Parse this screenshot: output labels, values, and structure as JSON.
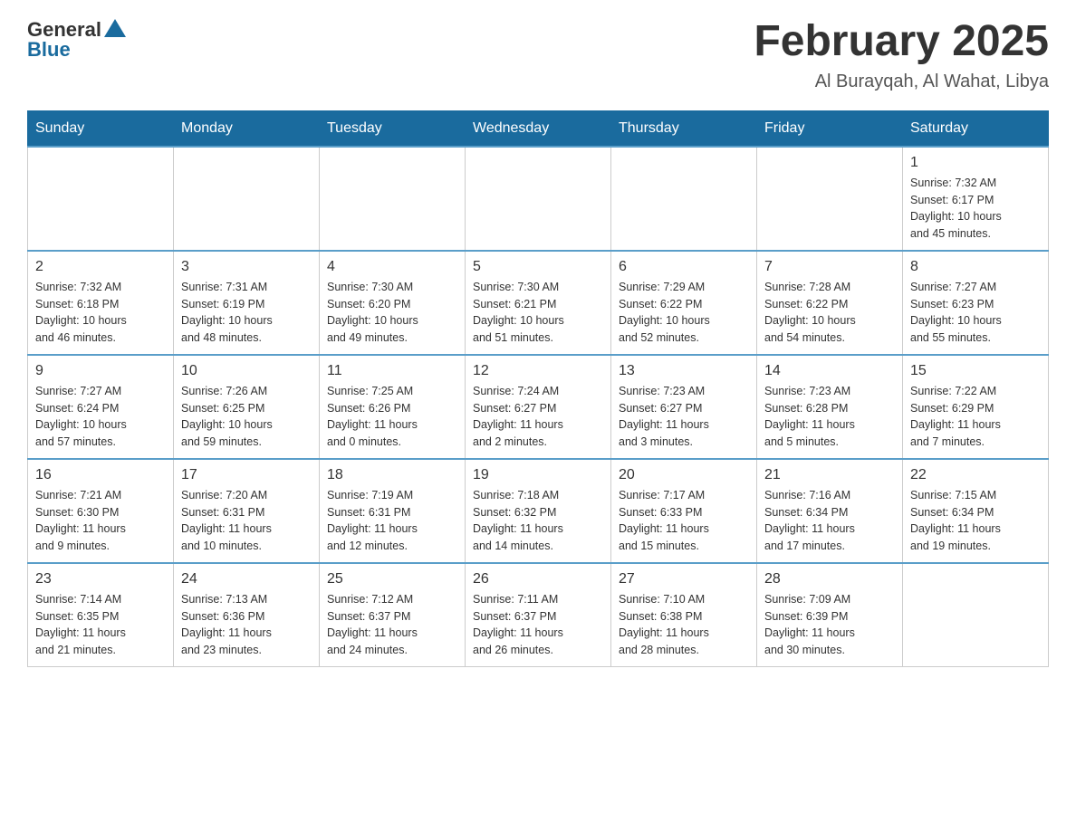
{
  "header": {
    "logo": {
      "text_general": "General",
      "text_blue": "Blue"
    },
    "title": "February 2025",
    "subtitle": "Al Burayqah, Al Wahat, Libya"
  },
  "days_of_week": [
    "Sunday",
    "Monday",
    "Tuesday",
    "Wednesday",
    "Thursday",
    "Friday",
    "Saturday"
  ],
  "weeks": [
    {
      "days": [
        {
          "num": "",
          "info": ""
        },
        {
          "num": "",
          "info": ""
        },
        {
          "num": "",
          "info": ""
        },
        {
          "num": "",
          "info": ""
        },
        {
          "num": "",
          "info": ""
        },
        {
          "num": "",
          "info": ""
        },
        {
          "num": "1",
          "info": "Sunrise: 7:32 AM\nSunset: 6:17 PM\nDaylight: 10 hours\nand 45 minutes."
        }
      ]
    },
    {
      "days": [
        {
          "num": "2",
          "info": "Sunrise: 7:32 AM\nSunset: 6:18 PM\nDaylight: 10 hours\nand 46 minutes."
        },
        {
          "num": "3",
          "info": "Sunrise: 7:31 AM\nSunset: 6:19 PM\nDaylight: 10 hours\nand 48 minutes."
        },
        {
          "num": "4",
          "info": "Sunrise: 7:30 AM\nSunset: 6:20 PM\nDaylight: 10 hours\nand 49 minutes."
        },
        {
          "num": "5",
          "info": "Sunrise: 7:30 AM\nSunset: 6:21 PM\nDaylight: 10 hours\nand 51 minutes."
        },
        {
          "num": "6",
          "info": "Sunrise: 7:29 AM\nSunset: 6:22 PM\nDaylight: 10 hours\nand 52 minutes."
        },
        {
          "num": "7",
          "info": "Sunrise: 7:28 AM\nSunset: 6:22 PM\nDaylight: 10 hours\nand 54 minutes."
        },
        {
          "num": "8",
          "info": "Sunrise: 7:27 AM\nSunset: 6:23 PM\nDaylight: 10 hours\nand 55 minutes."
        }
      ]
    },
    {
      "days": [
        {
          "num": "9",
          "info": "Sunrise: 7:27 AM\nSunset: 6:24 PM\nDaylight: 10 hours\nand 57 minutes."
        },
        {
          "num": "10",
          "info": "Sunrise: 7:26 AM\nSunset: 6:25 PM\nDaylight: 10 hours\nand 59 minutes."
        },
        {
          "num": "11",
          "info": "Sunrise: 7:25 AM\nSunset: 6:26 PM\nDaylight: 11 hours\nand 0 minutes."
        },
        {
          "num": "12",
          "info": "Sunrise: 7:24 AM\nSunset: 6:27 PM\nDaylight: 11 hours\nand 2 minutes."
        },
        {
          "num": "13",
          "info": "Sunrise: 7:23 AM\nSunset: 6:27 PM\nDaylight: 11 hours\nand 3 minutes."
        },
        {
          "num": "14",
          "info": "Sunrise: 7:23 AM\nSunset: 6:28 PM\nDaylight: 11 hours\nand 5 minutes."
        },
        {
          "num": "15",
          "info": "Sunrise: 7:22 AM\nSunset: 6:29 PM\nDaylight: 11 hours\nand 7 minutes."
        }
      ]
    },
    {
      "days": [
        {
          "num": "16",
          "info": "Sunrise: 7:21 AM\nSunset: 6:30 PM\nDaylight: 11 hours\nand 9 minutes."
        },
        {
          "num": "17",
          "info": "Sunrise: 7:20 AM\nSunset: 6:31 PM\nDaylight: 11 hours\nand 10 minutes."
        },
        {
          "num": "18",
          "info": "Sunrise: 7:19 AM\nSunset: 6:31 PM\nDaylight: 11 hours\nand 12 minutes."
        },
        {
          "num": "19",
          "info": "Sunrise: 7:18 AM\nSunset: 6:32 PM\nDaylight: 11 hours\nand 14 minutes."
        },
        {
          "num": "20",
          "info": "Sunrise: 7:17 AM\nSunset: 6:33 PM\nDaylight: 11 hours\nand 15 minutes."
        },
        {
          "num": "21",
          "info": "Sunrise: 7:16 AM\nSunset: 6:34 PM\nDaylight: 11 hours\nand 17 minutes."
        },
        {
          "num": "22",
          "info": "Sunrise: 7:15 AM\nSunset: 6:34 PM\nDaylight: 11 hours\nand 19 minutes."
        }
      ]
    },
    {
      "days": [
        {
          "num": "23",
          "info": "Sunrise: 7:14 AM\nSunset: 6:35 PM\nDaylight: 11 hours\nand 21 minutes."
        },
        {
          "num": "24",
          "info": "Sunrise: 7:13 AM\nSunset: 6:36 PM\nDaylight: 11 hours\nand 23 minutes."
        },
        {
          "num": "25",
          "info": "Sunrise: 7:12 AM\nSunset: 6:37 PM\nDaylight: 11 hours\nand 24 minutes."
        },
        {
          "num": "26",
          "info": "Sunrise: 7:11 AM\nSunset: 6:37 PM\nDaylight: 11 hours\nand 26 minutes."
        },
        {
          "num": "27",
          "info": "Sunrise: 7:10 AM\nSunset: 6:38 PM\nDaylight: 11 hours\nand 28 minutes."
        },
        {
          "num": "28",
          "info": "Sunrise: 7:09 AM\nSunset: 6:39 PM\nDaylight: 11 hours\nand 30 minutes."
        },
        {
          "num": "",
          "info": ""
        }
      ]
    }
  ]
}
